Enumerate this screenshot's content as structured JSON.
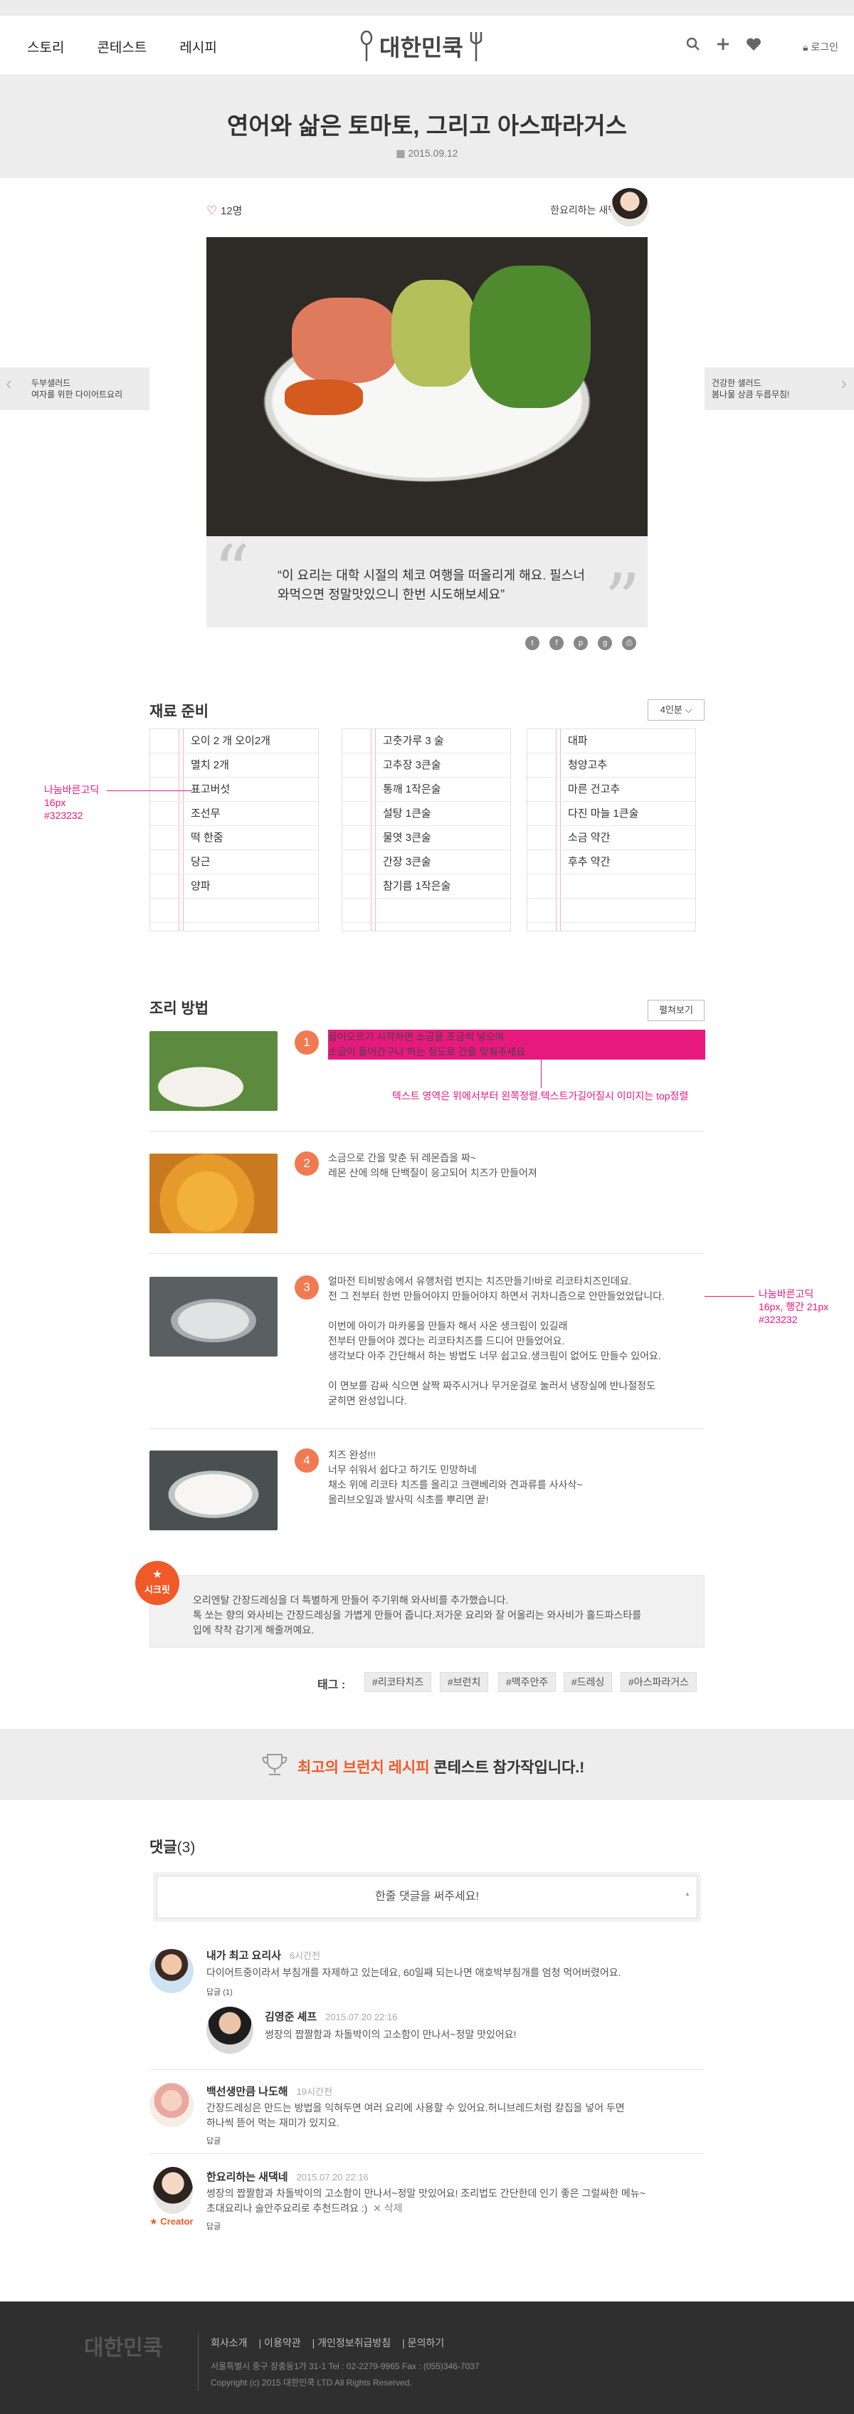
{
  "header": {
    "nav": [
      "스토리",
      "콘테스트",
      "레시피"
    ],
    "logo": "대한민쿡",
    "login": "로그인"
  },
  "post": {
    "title": "연어와 삶은 토마토, 그리고 아스파라거스",
    "date": "2015.09.12",
    "likes": "12명",
    "author": "한요리하는 새댁네",
    "quote": "“이 요리는 대학 시절의 체코 여행을 떠올리게 해요. 필스너와먹으면 정말맛있으니 한번 시도해보세요”"
  },
  "side": {
    "prev": [
      "두부샐러드",
      "여자를 위한 다이어트요리"
    ],
    "next": [
      "건강한 샐러드",
      "봄나물 상큼 두릅무침!"
    ]
  },
  "ingredients": {
    "title": "재료 준비",
    "servings": "4인분 ⌵",
    "col1": [
      "오이 2 개   오이2개",
      "멸치 2개",
      "표고버섯",
      "조선무",
      "떡 한줌",
      "당근",
      "양파"
    ],
    "col2": [
      "고춧가루 3 술",
      "고추장 3큰술",
      "통깨 1작은술",
      "설탕 1큰술",
      "물엿 3큰술",
      "간장 3큰술",
      "참기름 1작은술"
    ],
    "col3": [
      "대파",
      "청양고추",
      "마른 건고추",
      "다진 마늘 1큰술",
      "소금 약간",
      "후추 약간"
    ],
    "annotation": [
      "나눔바른고딕",
      "16px",
      "#323232"
    ]
  },
  "steps": {
    "title": "조리 방법",
    "expand": "펼쳐보기",
    "items": [
      {
        "num": "1",
        "lines": [
          "끓어오르기 시작하면 소금을 조금씩 넣으며",
          "소금이 들어간구나 하는 정도로 간을 맞춰주세요"
        ]
      },
      {
        "num": "2",
        "lines": [
          "소금으로 간을 맞춘 뒤 레몬즙을 짜~",
          "레몬 산에 의해 단백질이 응고되어 치즈가 만들어져"
        ]
      },
      {
        "num": "3",
        "lines": [
          "얼마전 티비방송에서 유행처럼 번지는 치즈만들기!바로 리코타치즈인데요.",
          "전 그 전부터 한번 만들어야지 만들어야지 하면서 귀차니즘으로 안만들었었답니다.",
          "",
          "이번에 아이가 마카롱을 만들자 해서 사온 생크림이 있길래",
          "전부터 만들어야 겠다는 리코타치즈를 드디어 만들었어요.",
          "생각보다 아주 간단해서 하는 방법도 너무 쉽고요.생크림이 없어도 만들수 있어요.",
          "",
          "이 면보를 감싸 식으면 살짝 짜주시거나 무거운걸로 눌러서 냉장실에 반나절정도",
          "굳히면 완성입니다."
        ]
      },
      {
        "num": "4",
        "lines": [
          "치즈 완성!!!",
          "너무 쉬워서 쉽다고 하기도 민망하네",
          "채소 위에 리코타 치즈를 올리고 크랜베리와 견과류를 사사삭~",
          "올리브오일과 발사믹 식초를 뿌리면 끝!"
        ]
      }
    ],
    "annot1": "텍스트 영역은 위에서부터 왼쪽정렬.텍스트가길어질시 이미지는 top정렬",
    "annot2": [
      "나눔바른고딕",
      "16px, 행간 21px",
      "#323232"
    ]
  },
  "tip": {
    "badge": "시크릿",
    "lines": [
      "오리엔탈 간장드레싱을 더 특별하게 만들어 주기위해 와사비를 추가했습니다.",
      "톡 쏘는 향의 와사비는 간장드레싱을 가볍게 만들어 줍니다.저가운 요리와 잘 어울리는 와사비가 홀드파스타를",
      "입에 착착 감기게 해줄꺼예요."
    ]
  },
  "tags": {
    "label": "태그 :",
    "items": [
      "#리코타치즈",
      "#브런치",
      "#맥주안주",
      "#드레싱",
      "#아스파라거스"
    ]
  },
  "contest": {
    "highlight": "최고의 브런치 레시피",
    "rest": " 콘테스트 참가작입니다.!"
  },
  "comments": {
    "title": "댓글",
    "count": "(3)",
    "placeholder": "한줄 댓글을 써주세요!",
    "items": [
      {
        "name": "내가 최고 요리사",
        "time": "6시간전",
        "text": "다이어트중이라서 부침개를 자제하고 있는데요, 60일째 되는나면 애호박부침개를 엄청 먹어버렸어요.",
        "reply": "답글 (1)"
      },
      {
        "name": "김영준 셰프",
        "time": "2015.07.20  22:16",
        "text": "썽장의 짭짤함과 차돌박이의 고소함이 만나서~정말 맛있어요!"
      },
      {
        "name": "백선생만큼 나도해",
        "time": "19시간전",
        "text1": "간장드레싱은 만드는 방법을 익혀두면 여러 요리에 사용할 수 있어요.허니브레드처럼 칼집을 넣어 두면",
        "text2": "하나씩 뜯어 먹는 재미가 있지요.",
        "reply": "답글"
      },
      {
        "name": "한요리하는 새댁네",
        "time": "2015.07.20  22:16",
        "text1": "썽장의 짭짤함과 차돌박이의 고소함이 만나서~정말 맛있어요! 조리법도 간단한데 인기 좋은 그럴싸한 메뉴~",
        "text2": "초대요리나 술안주요리로 추천드려요 :)",
        "delete": "✕ 삭제",
        "creator": "Creator",
        "reply": "답글"
      }
    ]
  },
  "footer": {
    "logo": "대한민쿡",
    "links": [
      "회사소개",
      "|  이용약관",
      "|  개인정보취급방침",
      "|  문의하기"
    ],
    "address": "서울특별시 중구 장충동1가 31-1  Tel : 02-2279-9965   Fax : (055)346-7037",
    "copyright": "Copyright (c) 2015 대한민쿡 LTD All Rights Reserved."
  },
  "colors": {
    "accent": "#e8197e",
    "step": "#f07a52",
    "badge": "#f05a28"
  }
}
